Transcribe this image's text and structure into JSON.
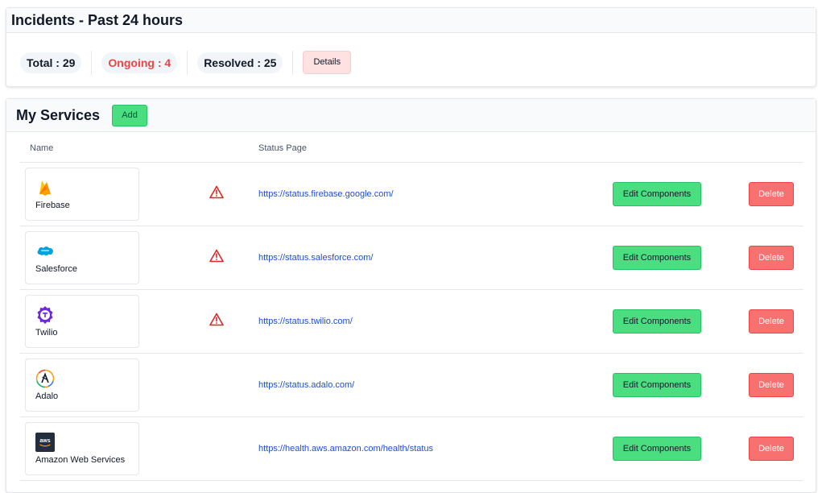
{
  "incidents": {
    "title": "Incidents - Past 24 hours",
    "total": "Total : 29",
    "ongoing": "Ongoing : 4",
    "resolved": "Resolved : 25",
    "details_label": "Details"
  },
  "services": {
    "title": "My Services",
    "add_label": "Add",
    "columns": {
      "name": "Name",
      "status_page": "Status Page"
    },
    "rows": [
      {
        "name": "Firebase",
        "icon": "firebase-icon",
        "alert": true,
        "status_url": "https://status.firebase.google.com/",
        "edit_label": "Edit Components",
        "delete_label": "Delete"
      },
      {
        "name": "Salesforce",
        "icon": "salesforce-icon",
        "alert": true,
        "status_url": "https://status.salesforce.com/",
        "edit_label": "Edit Components",
        "delete_label": "Delete"
      },
      {
        "name": "Twilio",
        "icon": "twilio-icon",
        "alert": true,
        "status_url": "https://status.twilio.com/",
        "edit_label": "Edit Components",
        "delete_label": "Delete"
      },
      {
        "name": "Adalo",
        "icon": "adalo-icon",
        "alert": false,
        "status_url": "https://status.adalo.com/",
        "edit_label": "Edit Components",
        "delete_label": "Delete"
      },
      {
        "name": "Amazon Web Services",
        "icon": "aws-icon",
        "alert": false,
        "status_url": "https://health.aws.amazon.com/health/status",
        "edit_label": "Edit Components",
        "delete_label": "Delete"
      }
    ]
  },
  "colors": {
    "ongoing": "#ef4444",
    "link": "#1d4ed8",
    "edit_button": "#4ade80",
    "delete_button": "#f87171",
    "details_button": "#fee2e2",
    "warning_icon": "#dc2626"
  }
}
